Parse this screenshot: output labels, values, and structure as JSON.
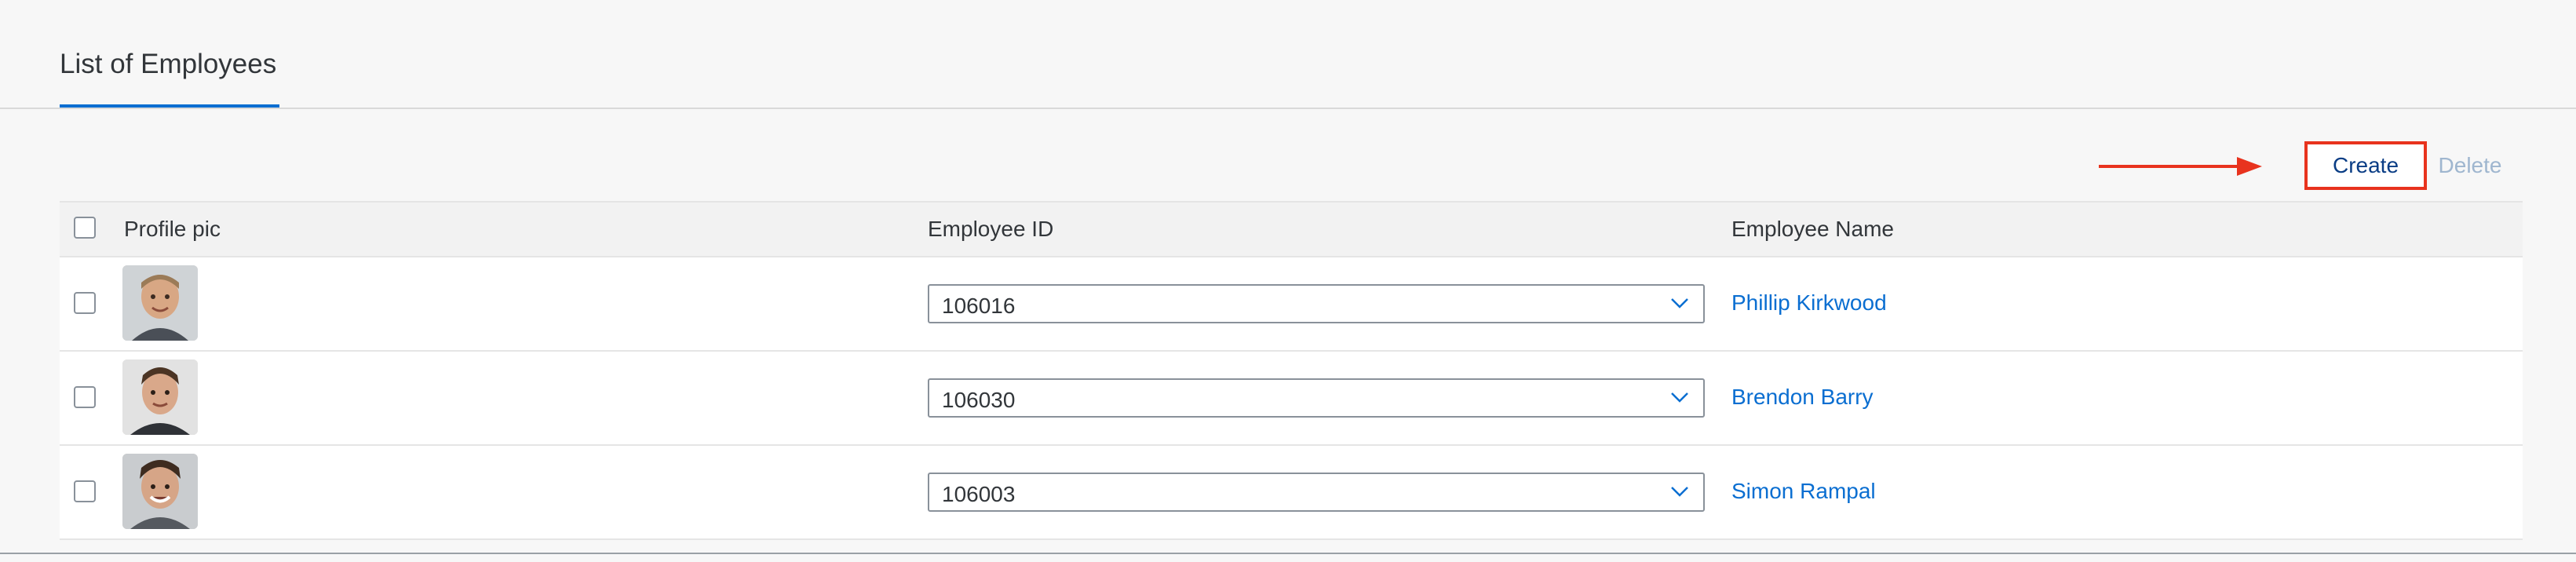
{
  "tabs": [
    {
      "label": "List of Employees",
      "selected": true
    }
  ],
  "toolbar": {
    "create_label": "Create",
    "delete_label": "Delete",
    "annotation_color": "#e8331e"
  },
  "table": {
    "columns": [
      "Profile pic",
      "Employee ID",
      "Employee Name"
    ],
    "rows": [
      {
        "employee_id": "106016",
        "employee_name": "Phillip Kirkwood"
      },
      {
        "employee_id": "106030",
        "employee_name": "Brendon Barry"
      },
      {
        "employee_id": "106003",
        "employee_name": "Simon Rampal"
      }
    ]
  },
  "colors": {
    "accent": "#0a6ed1",
    "link": "#0a6ed1",
    "highlight_box": "#e8331e"
  },
  "icons": {
    "dropdown": "chevron-down-icon",
    "annotation": "arrow-right-icon"
  }
}
